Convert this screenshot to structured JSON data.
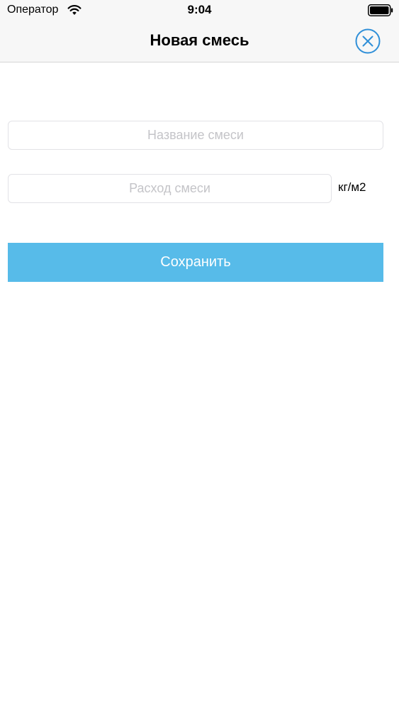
{
  "status_bar": {
    "carrier": "Оператор",
    "time": "9:04",
    "icons": [
      "wifi-icon",
      "battery-icon"
    ]
  },
  "nav": {
    "title": "Новая смесь",
    "close_icon": "close-circle-icon"
  },
  "form": {
    "name_field": {
      "placeholder": "Название смеси",
      "value": ""
    },
    "rate_field": {
      "placeholder": "Расход смеси",
      "value": ""
    },
    "rate_unit": "кг/м2",
    "save_label": "Сохранить"
  },
  "colors": {
    "accent": "#57bbe9",
    "close_icon": "#2f8fd8",
    "placeholder": "#c4c4c8",
    "bar_background": "#f7f7f7"
  }
}
